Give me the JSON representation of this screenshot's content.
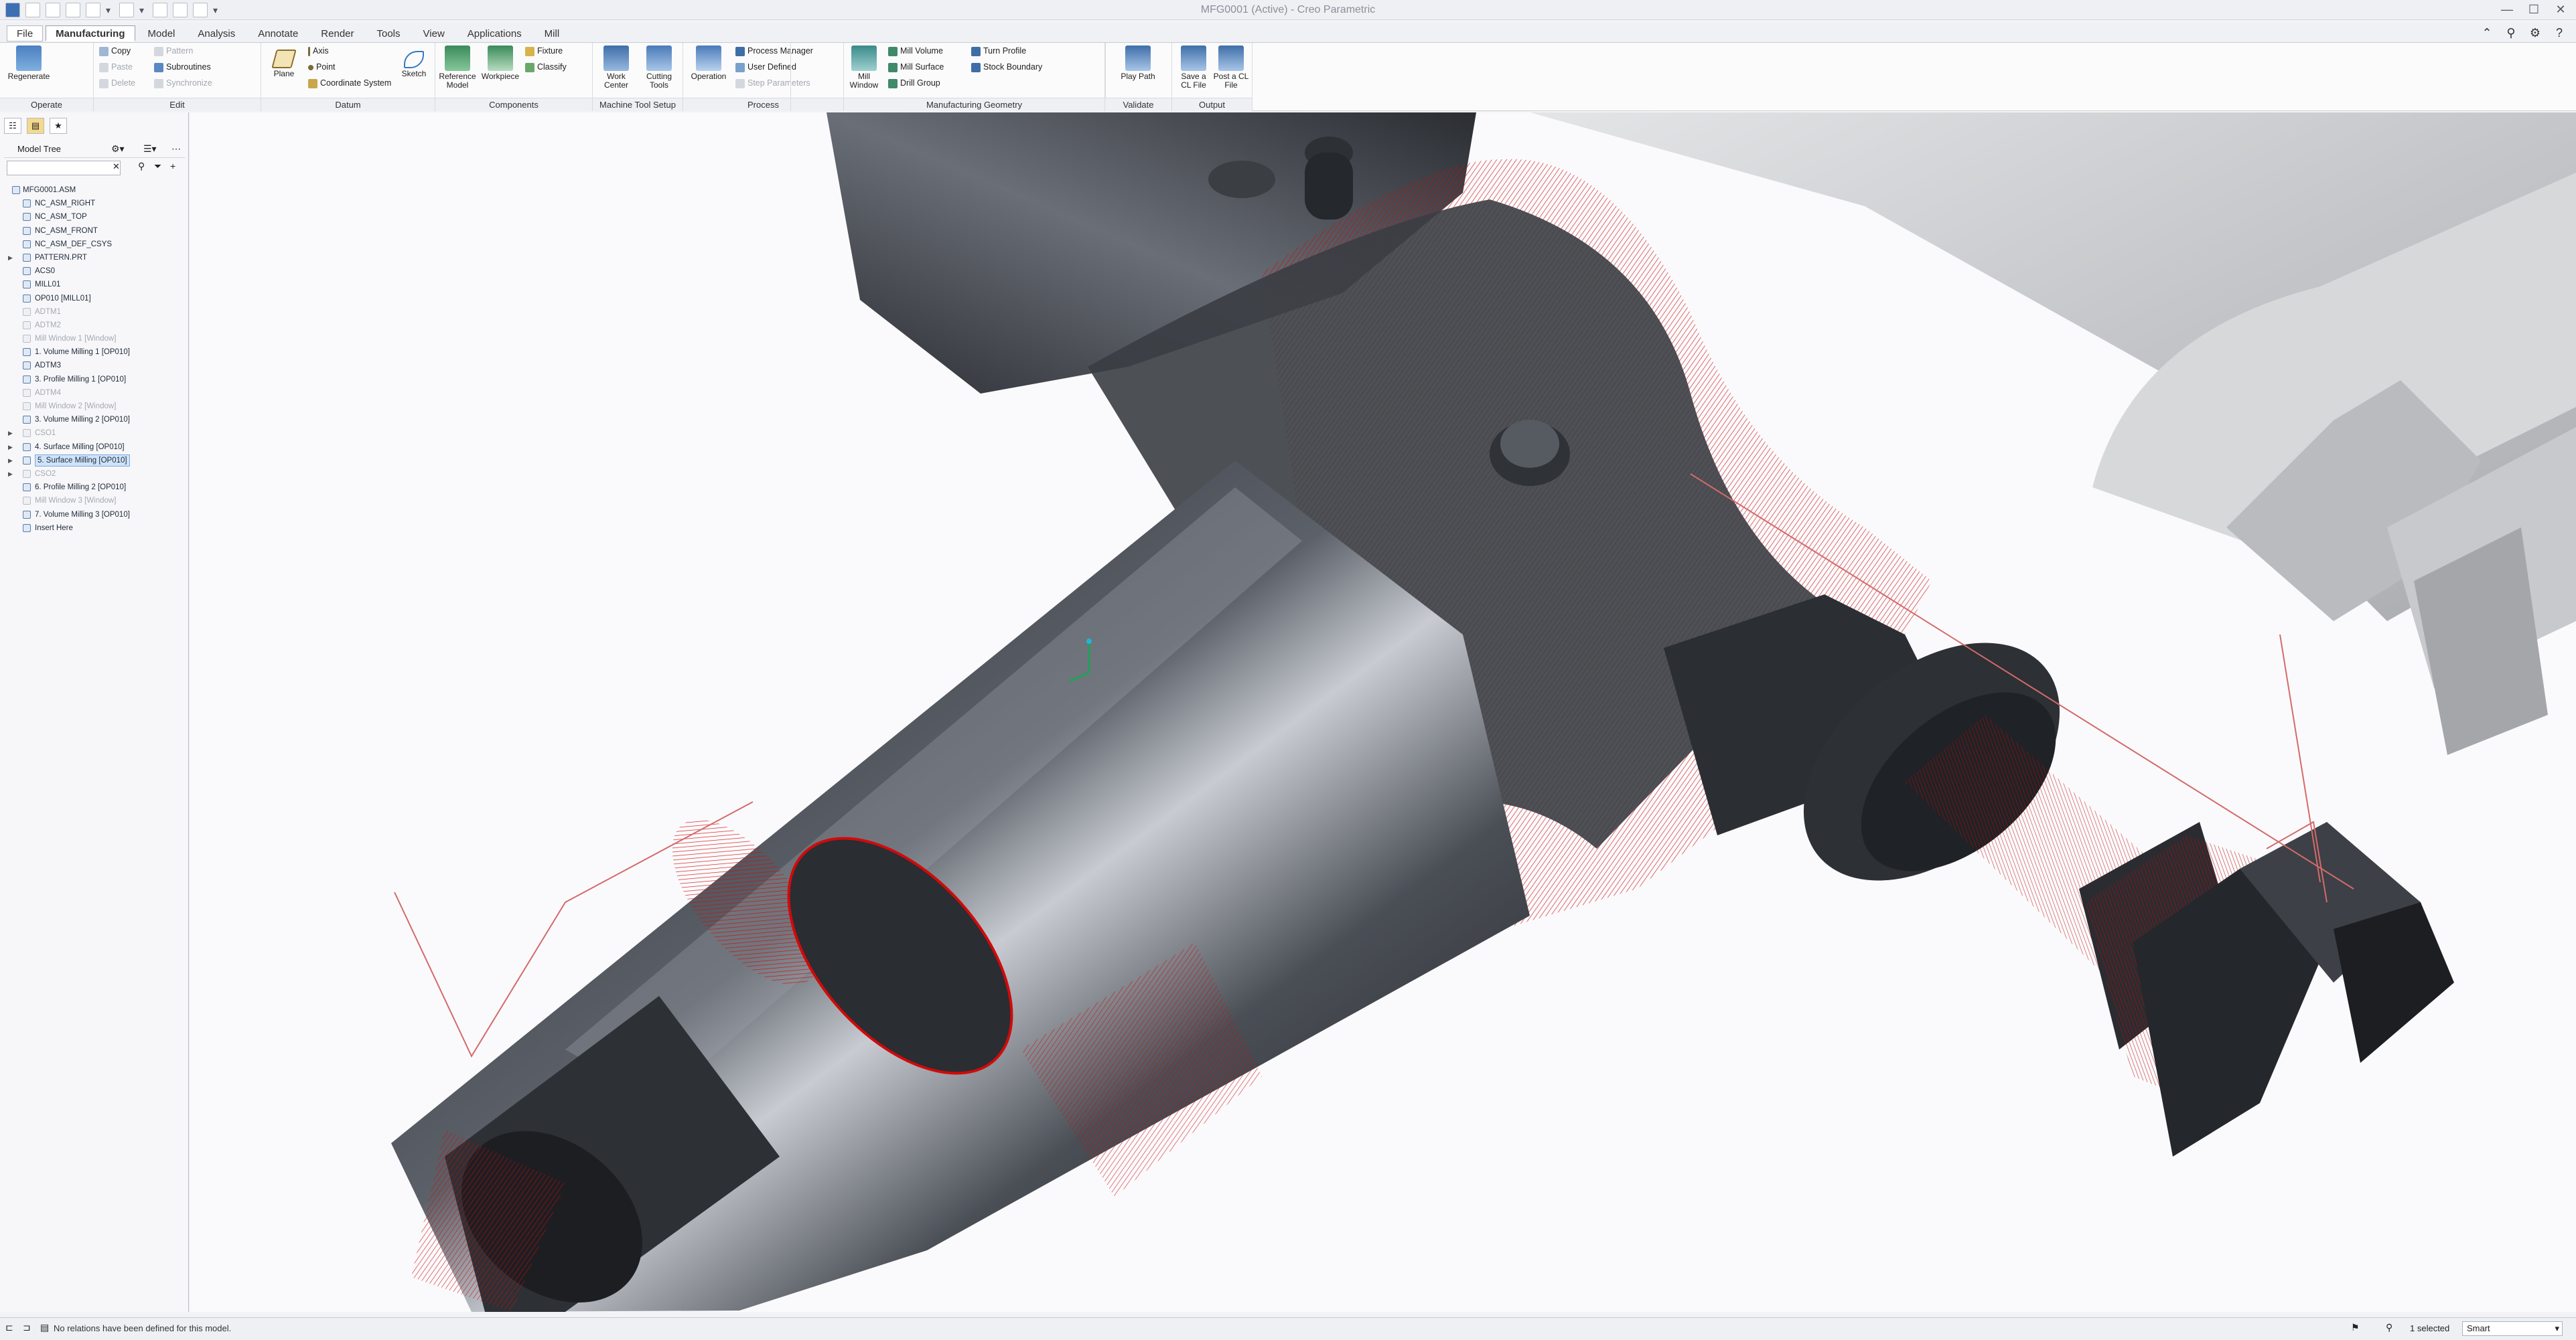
{
  "window": {
    "title": "MFG0001 (Active) - Creo Parametric"
  },
  "tabs": [
    "File",
    "Manufacturing",
    "Model",
    "Analysis",
    "Annotate",
    "Render",
    "Tools",
    "View",
    "Applications",
    "Mill"
  ],
  "ribbon": {
    "operate": {
      "label": "Operate",
      "regenerate": "Regenerate"
    },
    "edit": {
      "label": "Edit",
      "copy": "Copy",
      "paste": "Paste",
      "delete": "Delete",
      "pattern": "Pattern",
      "subroutines": "Subroutines",
      "synchronize": "Synchronize"
    },
    "datum": {
      "label": "Datum",
      "plane": "Plane",
      "axis": "Axis",
      "point": "Point",
      "coordinate_system": "Coordinate System",
      "sketch": "Sketch"
    },
    "components": {
      "label": "Components",
      "reference_model": "Reference Model",
      "workpiece": "Workpiece",
      "fixture": "Fixture",
      "classify": "Classify"
    },
    "machine": {
      "label": "Machine Tool Setup",
      "work_center": "Work Center",
      "cutting_tools": "Cutting Tools"
    },
    "process": {
      "label": "Process",
      "operation": "Operation",
      "process_manager": "Process Manager",
      "user_defined": "User Defined",
      "step_parameters": "Step Parameters"
    },
    "mfg_geometry": {
      "label": "Manufacturing Geometry",
      "mill_window": "Mill Window",
      "mill_volume": "Mill Volume",
      "mill_surface": "Mill Surface",
      "drill_group": "Drill Group",
      "turn_profile": "Turn Profile",
      "stock_boundary": "Stock Boundary"
    },
    "validate": {
      "label": "Validate",
      "play_path": "Play Path"
    },
    "output": {
      "label": "Output",
      "save_cl": "Save a CL File",
      "post_cl": "Post a CL File"
    }
  },
  "model_tree": {
    "title": "Model Tree",
    "search_placeholder": "",
    "nodes": [
      {
        "label": "MFG0001.ASM",
        "dim": false,
        "sel": false,
        "exp": ""
      },
      {
        "label": "NC_ASM_RIGHT",
        "dim": false,
        "sel": false,
        "exp": ""
      },
      {
        "label": "NC_ASM_TOP",
        "dim": false,
        "sel": false,
        "exp": ""
      },
      {
        "label": "NC_ASM_FRONT",
        "dim": false,
        "sel": false,
        "exp": ""
      },
      {
        "label": "NC_ASM_DEF_CSYS",
        "dim": false,
        "sel": false,
        "exp": ""
      },
      {
        "label": "PATTERN.PRT",
        "dim": false,
        "sel": false,
        "exp": "▶"
      },
      {
        "label": "ACS0",
        "dim": false,
        "sel": false,
        "exp": ""
      },
      {
        "label": "MILL01",
        "dim": false,
        "sel": false,
        "exp": ""
      },
      {
        "label": "OP010 [MILL01]",
        "dim": false,
        "sel": false,
        "exp": ""
      },
      {
        "label": "ADTM1",
        "dim": true,
        "sel": false,
        "exp": ""
      },
      {
        "label": "ADTM2",
        "dim": true,
        "sel": false,
        "exp": ""
      },
      {
        "label": "Mill Window 1 [Window]",
        "dim": true,
        "sel": false,
        "exp": ""
      },
      {
        "label": "1. Volume Milling 1 [OP010]",
        "dim": false,
        "sel": false,
        "exp": ""
      },
      {
        "label": "ADTM3",
        "dim": false,
        "sel": false,
        "exp": ""
      },
      {
        "label": "3. Profile Milling 1 [OP010]",
        "dim": false,
        "sel": false,
        "exp": ""
      },
      {
        "label": "ADTM4",
        "dim": true,
        "sel": false,
        "exp": ""
      },
      {
        "label": "Mill Window 2 [Window]",
        "dim": true,
        "sel": false,
        "exp": ""
      },
      {
        "label": "3. Volume Milling 2 [OP010]",
        "dim": false,
        "sel": false,
        "exp": ""
      },
      {
        "label": "CSO1",
        "dim": true,
        "sel": false,
        "exp": "▶"
      },
      {
        "label": "4. Surface Milling [OP010]",
        "dim": false,
        "sel": false,
        "exp": "▶"
      },
      {
        "label": "5. Surface Milling [OP010]",
        "dim": false,
        "sel": true,
        "exp": "▶"
      },
      {
        "label": "CSO2",
        "dim": true,
        "sel": false,
        "exp": "▶"
      },
      {
        "label": "6. Profile Milling 2 [OP010]",
        "dim": false,
        "sel": false,
        "exp": ""
      },
      {
        "label": "Mill Window 3 [Window]",
        "dim": true,
        "sel": false,
        "exp": ""
      },
      {
        "label": "7. Volume Milling 3 [OP010]",
        "dim": false,
        "sel": false,
        "exp": ""
      },
      {
        "label": "Insert Here",
        "dim": false,
        "sel": false,
        "exp": ""
      }
    ]
  },
  "status": {
    "message": "No relations have been defined for this model.",
    "selected": "1 selected",
    "filter": "Smart"
  },
  "colors": {
    "accent": "#2a6fd0",
    "toolpath": "#d10a0a",
    "part": "#3a3d42",
    "stock": "#cfd0d2"
  }
}
